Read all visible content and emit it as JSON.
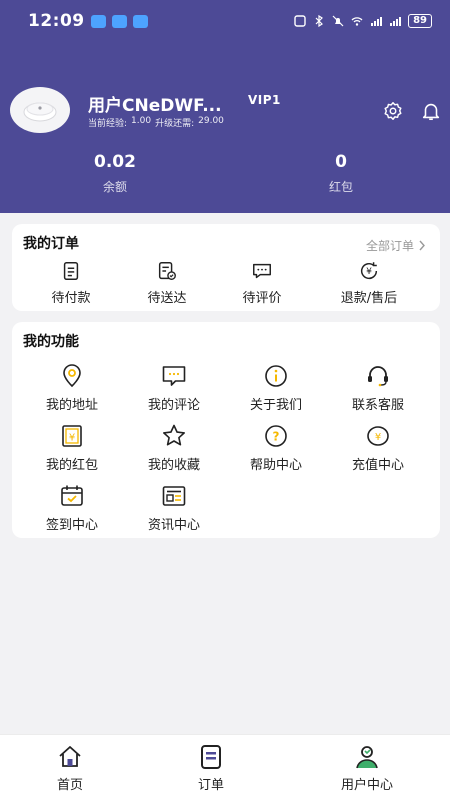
{
  "status_bar": {
    "time": "12:09",
    "battery": "89"
  },
  "profile": {
    "name": "用户CNeDWF...",
    "vip": "VIP1",
    "exp_label": "当前经验:",
    "exp_value": "1.00",
    "upgrade_label": "升级还需:",
    "upgrade_value": "29.00"
  },
  "stats": [
    {
      "value": "0.02",
      "label": "余额"
    },
    {
      "value": "0",
      "label": "红包"
    }
  ],
  "orders": {
    "title": "我的订单",
    "all_link": "全部订单",
    "items": [
      {
        "label": "待付款",
        "icon": "clipboard-list-icon"
      },
      {
        "label": "待送达",
        "icon": "delivery-doc-icon"
      },
      {
        "label": "待评价",
        "icon": "comment-dots-icon"
      },
      {
        "label": "退款/售后",
        "icon": "refund-yen-icon"
      }
    ]
  },
  "functions": {
    "title": "我的功能",
    "items": [
      {
        "label": "我的地址",
        "icon": "location-pin-icon"
      },
      {
        "label": "我的评论",
        "icon": "chat-bubble-icon"
      },
      {
        "label": "关于我们",
        "icon": "info-icon"
      },
      {
        "label": "联系客服",
        "icon": "headset-icon"
      },
      {
        "label": "我的红包",
        "icon": "red-packet-icon"
      },
      {
        "label": "我的收藏",
        "icon": "star-icon"
      },
      {
        "label": "帮助中心",
        "icon": "help-icon"
      },
      {
        "label": "充值中心",
        "icon": "recharge-icon"
      },
      {
        "label": "签到中心",
        "icon": "calendar-check-icon"
      },
      {
        "label": "资讯中心",
        "icon": "news-icon"
      }
    ]
  },
  "tabs": [
    {
      "label": "首页",
      "icon": "home-icon"
    },
    {
      "label": "订单",
      "icon": "order-icon"
    },
    {
      "label": "用户中心",
      "icon": "user-center-icon"
    }
  ],
  "colors": {
    "header": "#4d4a96",
    "accent": "#f5b800",
    "icon_stroke": "#222222"
  }
}
